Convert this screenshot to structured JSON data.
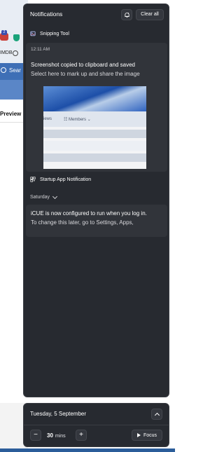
{
  "background": {
    "ext_badge": "2",
    "imdb_label": "IMDB",
    "search_label": "Sear",
    "preview_label": "Preview"
  },
  "panel": {
    "title": "Notifications",
    "clear_all": "Clear all"
  },
  "snipping": {
    "app_name": "Snipping Tool",
    "time": "12:11 AM",
    "title": "Screenshot copied to clipboard and saved",
    "body": "Select here to mark up and share the image",
    "thumb_nav_1": "iews",
    "thumb_nav_2": "☷ Members ⌄"
  },
  "startup": {
    "app_name": "Startup App Notification",
    "group_label": "Saturday",
    "title": "iCUE is now configured to run when you log in.",
    "body": "To change this later, go to Settings, Apps,"
  },
  "calendar": {
    "date": "Tuesday, 5 September",
    "minus": "−",
    "plus": "+",
    "minutes_value": "30",
    "minutes_unit": "mins",
    "focus_label": "Focus"
  },
  "colors": {
    "panel_bg": "#272a30",
    "card_bg": "#31343a",
    "accent_blue": "#3e6fb6"
  }
}
